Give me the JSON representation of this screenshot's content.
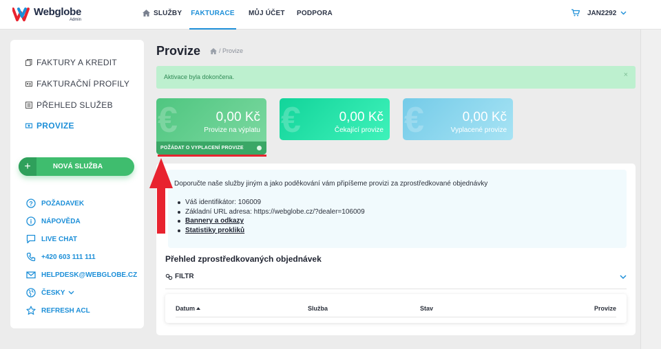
{
  "brand": {
    "name": "Webglobe",
    "sub": "Admin"
  },
  "nav": {
    "items": [
      {
        "label": "SLUŽBY",
        "icon": "home-icon"
      },
      {
        "label": "FAKTURACE",
        "active": true
      },
      {
        "label": "MŮJ ÚČET"
      },
      {
        "label": "PODPORA"
      }
    ],
    "user": "JAN2292"
  },
  "sidebar": {
    "items": [
      {
        "label": "FAKTURY A KREDIT",
        "icon": "copy-icon"
      },
      {
        "label": "FAKTURAČNÍ PROFILY",
        "icon": "id-card-icon"
      },
      {
        "label": "PŘEHLED SLUŽEB",
        "icon": "list-icon"
      },
      {
        "label": "PROVIZE",
        "icon": "money-icon",
        "active": true
      }
    ],
    "new_service_label": "NOVÁ SLUŽBA",
    "new_service_icon": "+",
    "help": [
      {
        "label": "POŽADAVEK",
        "icon": "question-icon"
      },
      {
        "label": "NÁPOVĚDA",
        "icon": "info-icon"
      },
      {
        "label": "LIVE CHAT",
        "icon": "chat-icon"
      },
      {
        "label": "+420 603 111 111",
        "icon": "phone-icon"
      },
      {
        "label": "HELPDESK@WEBGLOBE.CZ",
        "icon": "mail-icon"
      },
      {
        "label": "ČESKY",
        "icon": "globe-icon"
      },
      {
        "label": "REFRESH ACL",
        "icon": "star-icon"
      }
    ]
  },
  "page": {
    "title": "Provize",
    "breadcrumb": "/ Provize"
  },
  "alert": {
    "text": "Aktivace byla dokončena.",
    "close": "×"
  },
  "cards": [
    {
      "amount": "0,00 Kč",
      "label": "Provize na výplatu",
      "action": "POŽÁDAT O VYPLACENÍ PROVIZE",
      "color": "#4fc680"
    },
    {
      "amount": "0,00 Kč",
      "label": "Čekající provize",
      "color": "#12d49a"
    },
    {
      "amount": "0,00 Kč",
      "label": "Vyplacené provize",
      "color": "#74cbe8"
    }
  ],
  "info": {
    "text": "Doporučte naše služby jiným a jako poděkování vám připíšeme provizi za zprostředkované objednávky",
    "items": [
      "Váš identifikátor: 106009",
      "Základní URL adresa: https://webglobe.cz/?dealer=106009"
    ],
    "links": [
      "Bannery a odkazy",
      "Statistiky prokliků"
    ]
  },
  "orders": {
    "title": "Přehled zprostředkovaných objednávek",
    "filter_label": "FILTR",
    "columns": [
      "Datum",
      "Služba",
      "Stav",
      "Provize"
    ]
  }
}
